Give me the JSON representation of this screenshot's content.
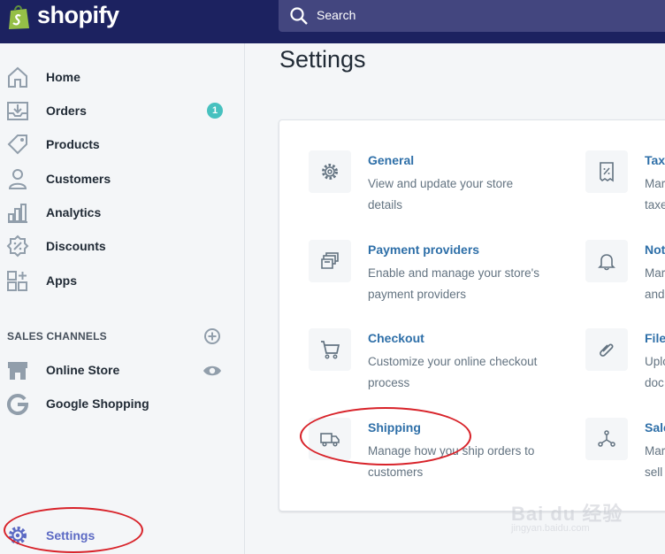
{
  "brand": {
    "name": "shopify"
  },
  "search": {
    "placeholder": "Search"
  },
  "sidebar": {
    "items": [
      {
        "label": "Home",
        "icon": "home-icon"
      },
      {
        "label": "Orders",
        "icon": "orders-icon",
        "badge": "1"
      },
      {
        "label": "Products",
        "icon": "tag-icon"
      },
      {
        "label": "Customers",
        "icon": "person-icon"
      },
      {
        "label": "Analytics",
        "icon": "bar-chart-icon"
      },
      {
        "label": "Discounts",
        "icon": "discount-icon"
      },
      {
        "label": "Apps",
        "icon": "apps-icon"
      }
    ],
    "sales_channels_title": "SALES CHANNELS",
    "channels": [
      {
        "label": "Online Store",
        "icon": "store-icon",
        "action_icon": "eye-icon"
      },
      {
        "label": "Google Shopping",
        "icon": "google-icon"
      }
    ],
    "settings_label": "Settings"
  },
  "main": {
    "title": "Settings",
    "settings": [
      {
        "title": "General",
        "desc1": "View and update your store",
        "desc2": "details",
        "icon": "gear-icon"
      },
      {
        "title": "Payment providers",
        "desc1": "Enable and manage your store's",
        "desc2": "payment providers",
        "icon": "payment-icon"
      },
      {
        "title": "Checkout",
        "desc1": "Customize your online checkout",
        "desc2": "process",
        "icon": "cart-icon"
      },
      {
        "title": "Shipping",
        "desc1": "Manage how you ship orders to",
        "desc2": "customers",
        "icon": "truck-icon"
      },
      {
        "title": "Taxe",
        "desc1": "Mar",
        "desc2": "taxe",
        "icon": "receipt-icon"
      },
      {
        "title": "Not",
        "desc1": "Mar",
        "desc2": "and",
        "icon": "bell-icon"
      },
      {
        "title": "File",
        "desc1": "Uplo",
        "desc2": "doc",
        "icon": "paperclip-icon"
      },
      {
        "title": "Sale",
        "desc1": "Mar",
        "desc2": "sell",
        "icon": "channels-icon"
      }
    ]
  },
  "watermark": {
    "text": "Bai du 经验",
    "sub": "jingyan.baidu.com"
  },
  "colors": {
    "topbar": "#1c2260",
    "accent": "#5c6ac4",
    "link": "#2e6fa8",
    "badge": "#47c1bf",
    "annotation": "#d8232a"
  }
}
